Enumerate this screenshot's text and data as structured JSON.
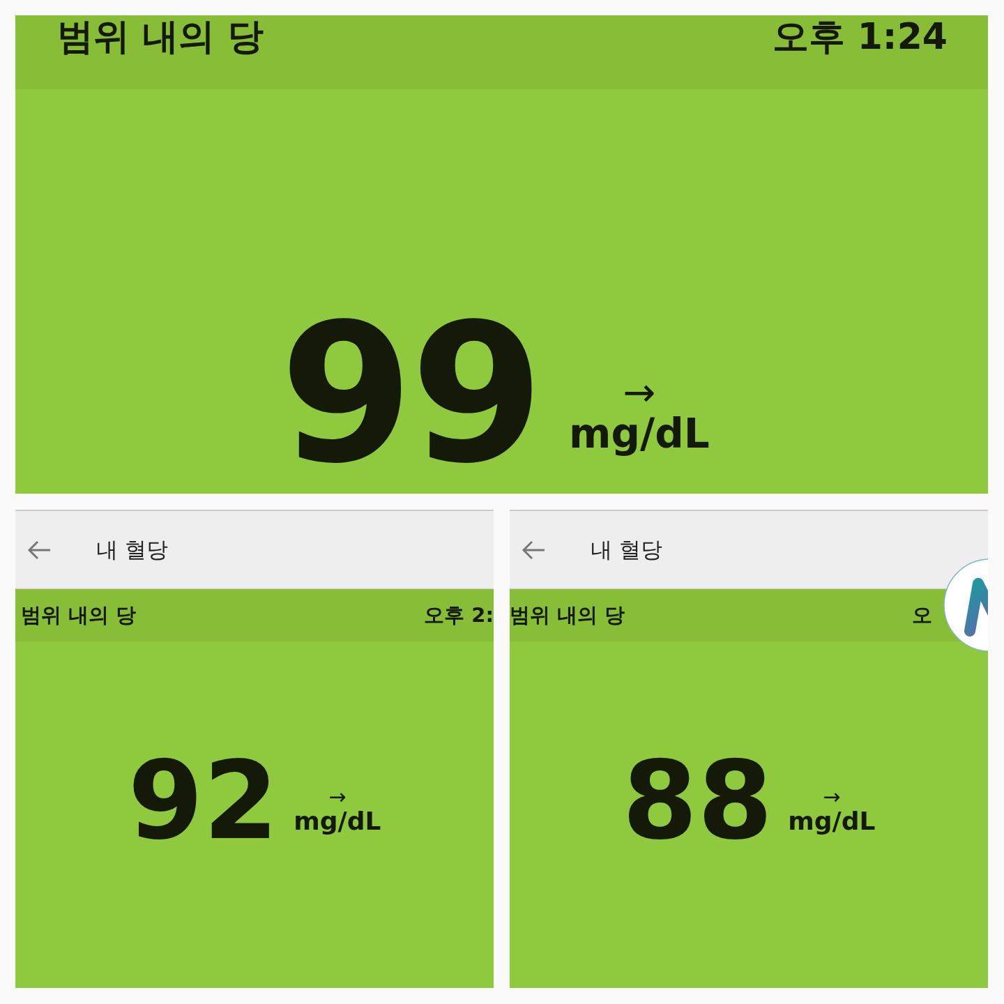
{
  "panels": [
    {
      "kind": "full",
      "status_label": "범위 내의 당",
      "time": "오후 1:24",
      "value": "99",
      "trend": "→",
      "unit": "mg/dL"
    },
    {
      "kind": "app",
      "appbar_title": "내 혈당",
      "status_label": "범위 내의 당",
      "time": "오후 2:",
      "value": "92",
      "trend": "→",
      "unit": "mg/dL"
    },
    {
      "kind": "app",
      "appbar_title": "내 혈당",
      "status_label": "범위 내의 당",
      "time": "오",
      "value": "88",
      "trend": "→",
      "unit": "mg/dL",
      "floating_badge": true
    }
  ]
}
